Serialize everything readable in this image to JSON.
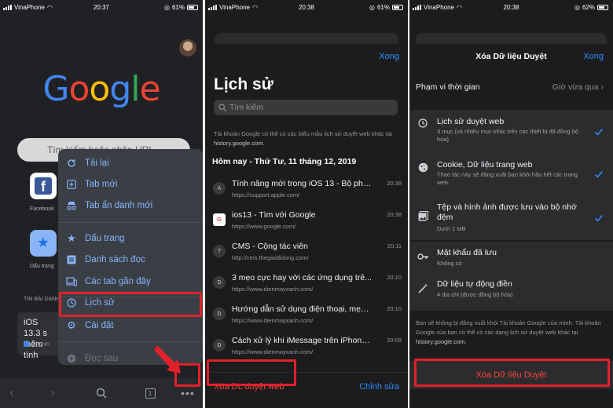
{
  "panel1": {
    "status": {
      "carrier": "VinaPhone",
      "time": "20:37",
      "battery": "61%"
    },
    "logo": {
      "letters": [
        "G",
        "o",
        "o",
        "g",
        "l",
        "e"
      ],
      "colors": [
        "#4285F4",
        "#EA4335",
        "#FBBC05",
        "#4285F4",
        "#34A853",
        "#EA4335"
      ]
    },
    "search_placeholder": "Tìm kiếm hoặc nhập URL",
    "shortcuts": [
      {
        "label": "Facebook",
        "icon": "facebook-icon"
      },
      {
        "label": "Dấu trang",
        "icon": "star-icon"
      }
    ],
    "news_header": "TIN BÀI DÀNH",
    "news_title": "iOS 13.3 s\nthêm tính",
    "news_source": "Zing.vn",
    "menu": [
      {
        "label": "Tải lại",
        "icon": "reload-icon"
      },
      {
        "label": "Tab mới",
        "icon": "plus-icon"
      },
      {
        "label": "Tab ẩn danh mới",
        "icon": "incognito-icon"
      },
      {
        "label": "Dấu trang",
        "icon": "star-icon"
      },
      {
        "label": "Danh sách đọc",
        "icon": "list-icon"
      },
      {
        "label": "Các tab gần đây",
        "icon": "devices-icon"
      },
      {
        "label": "Lịch sử",
        "icon": "history-icon"
      },
      {
        "label": "Cài đặt",
        "icon": "gear-icon"
      },
      {
        "label": "Đọc sau",
        "icon": "add-circle-icon"
      }
    ],
    "toolbar": {
      "tab_count": "1"
    },
    "highlight_color": "#e1212a"
  },
  "panel2": {
    "status": {
      "carrier": "VinaPhone",
      "time": "20:38",
      "battery": "61%"
    },
    "done": "Xong",
    "title": "Lịch sử",
    "search_placeholder": "Tìm kiếm",
    "note_text": "Tài khoản Google có thể có các biểu mẫu lịch sử duyệt web khác tại ",
    "note_link": "history.google.com.",
    "day_header": "Hôm nay - Thứ Tư, 11 tháng 12, 2019",
    "entries": [
      {
        "letter": "A",
        "title": "Tính năng mới trong iOS 13 - Bộ phậ...",
        "url": "https://support.apple.com/",
        "time": "20:38"
      },
      {
        "letter": "",
        "title": "ios13 - Tìm với Google",
        "url": "https://www.google.com/",
        "time": "20:38"
      },
      {
        "letter": "T",
        "title": "CMS - Cộng tác viên",
        "url": "http://cms.thegioididong.com/",
        "time": "20:11"
      },
      {
        "letter": "D",
        "title": "3 mẹo cực hay với các ứng dụng trê...",
        "url": "https://www.dienmayxanh.com/",
        "time": "20:10"
      },
      {
        "letter": "D",
        "title": "Hướng dẫn sử dụng điện thoại, mẹo...",
        "url": "https://www.dienmayxanh.com/",
        "time": "20:10"
      },
      {
        "letter": "D",
        "title": "Cách xử lý khi iMessage trên iPhone,...",
        "url": "https://www.dienmayxanh.com/",
        "time": "20:09"
      }
    ],
    "clear_label": "Xóa DL duyệt web",
    "edit_label": "Chỉnh sửa"
  },
  "panel3": {
    "status": {
      "carrier": "VinaPhone",
      "time": "20:38",
      "battery": "62%"
    },
    "title": "Xóa Dữ liệu Duyệt",
    "done": "Xong",
    "range_label": "Phạm vi thời gian",
    "range_value": "Giờ vừa qua",
    "options": [
      {
        "title": "Lịch sử duyệt web",
        "subtitle": "3 mục (và nhiều mục khác trên các thiết bị đã đồng bộ hóa)",
        "icon": "history-icon",
        "checked": true
      },
      {
        "title": "Cookie, Dữ liệu trang web",
        "subtitle": "Thao tác này sẽ đăng xuất bạn khỏi hầu hết các trang web.",
        "icon": "cookie-icon",
        "checked": true
      },
      {
        "title": "Tệp và hình ảnh được lưu vào bộ nhớ đệm",
        "subtitle": "Dưới 1 MB",
        "icon": "image-icon",
        "checked": true
      },
      {
        "title": "Mật khẩu đã lưu",
        "subtitle": "Không có",
        "icon": "key-icon",
        "checked": false
      },
      {
        "title": "Dữ liệu tự động điền",
        "subtitle": "4 địa chỉ (được đồng bộ hóa)",
        "icon": "magic-wand-icon",
        "checked": false
      }
    ],
    "note_text": "Bạn sẽ không bị đăng xuất khỏi Tài khoản Google của mình. Tài khoản Google của bạn có thể có các dạng lịch sử duyệt web khác tại ",
    "note_link": "history.google.com.",
    "clear_button": "Xóa Dữ liệu Duyệt"
  }
}
